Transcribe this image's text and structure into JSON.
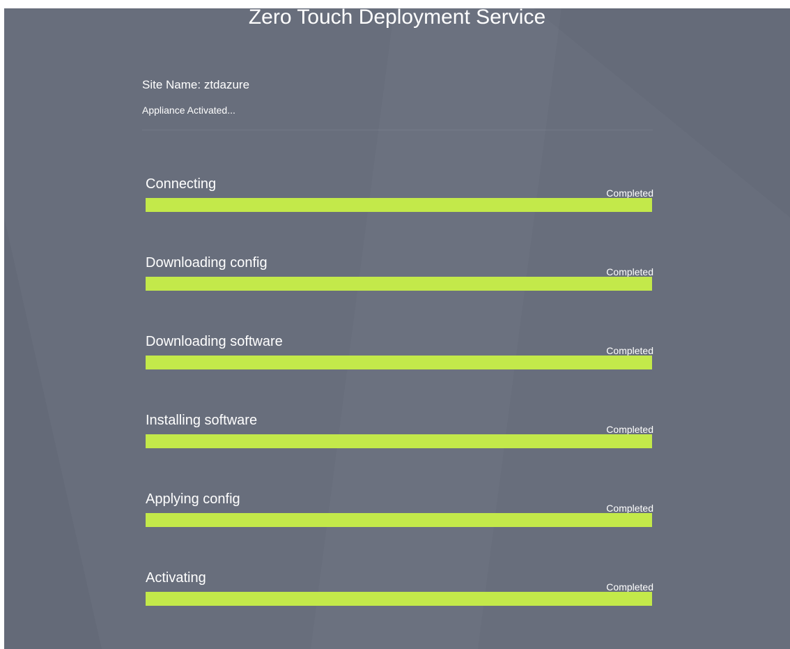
{
  "title": "Zero Touch Deployment Service",
  "site": {
    "label": "Site Name:",
    "value": "ztdazure"
  },
  "status_message": "Appliance Activated...",
  "colors": {
    "background": "#686e7c",
    "progress": "#c3e94a",
    "text": "#ffffff"
  },
  "steps": [
    {
      "label": "Connecting",
      "status": "Completed",
      "progress": 1.0
    },
    {
      "label": "Downloading config",
      "status": "Completed",
      "progress": 1.0
    },
    {
      "label": "Downloading software",
      "status": "Completed",
      "progress": 1.0
    },
    {
      "label": "Installing software",
      "status": "Completed",
      "progress": 1.0
    },
    {
      "label": "Applying config",
      "status": "Completed",
      "progress": 1.0
    },
    {
      "label": "Activating",
      "status": "Completed",
      "progress": 1.0
    }
  ]
}
